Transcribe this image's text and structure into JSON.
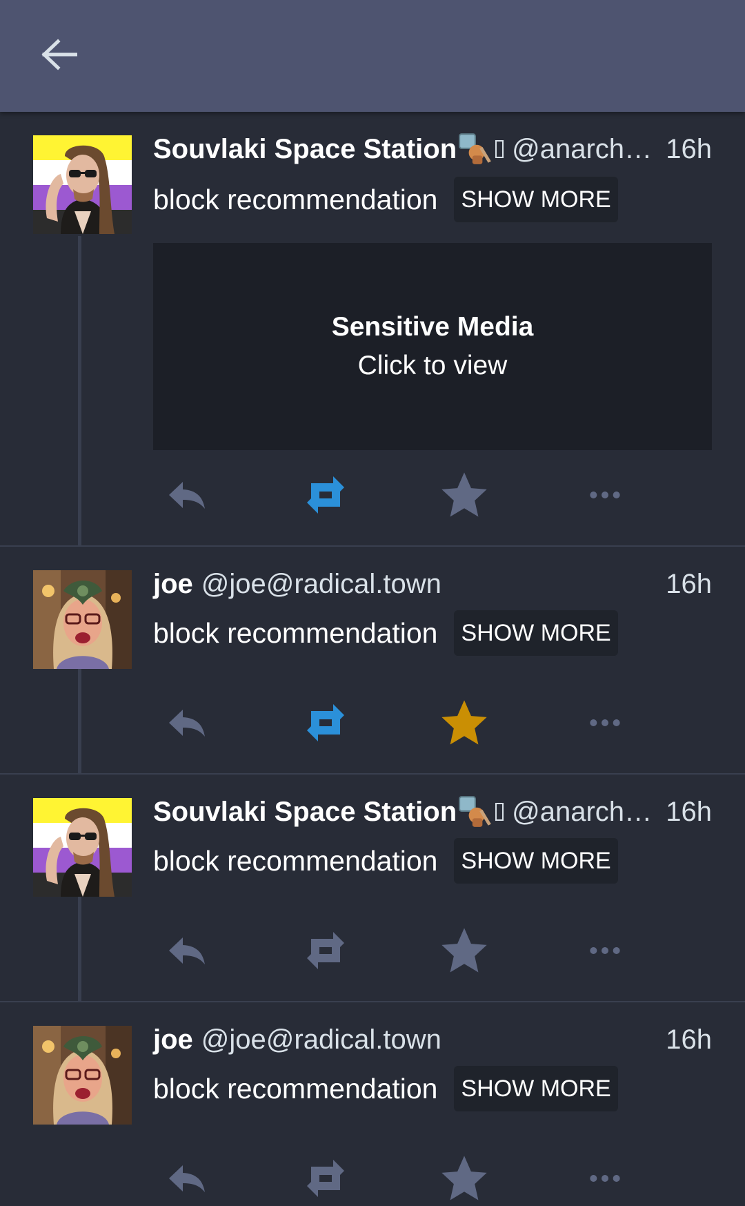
{
  "header": {
    "back_icon": "arrow-left-icon"
  },
  "colors": {
    "background": "#282c37",
    "header": "#4e5470",
    "icon_default": "#606984",
    "boosted": "#2b90d9",
    "favourited": "#ca8f04"
  },
  "statuses": [
    {
      "display_name": "Souvlaki Space Station",
      "account": "@anarchi…",
      "time": "16h",
      "content": "block recommendation",
      "show_more": "SHOW MORE",
      "sensitive": {
        "title": "Sensitive Media",
        "subtitle": "Click to view"
      },
      "boosted": true,
      "favourited": false,
      "avatar": "nonbinary-flag-avatar"
    },
    {
      "display_name": "joe",
      "account": "@joe@radical.town",
      "time": "16h",
      "content": "block recommendation",
      "show_more": "SHOW MORE",
      "boosted": true,
      "favourited": true,
      "avatar": "joe-avatar"
    },
    {
      "display_name": "Souvlaki Space Station",
      "account": "@anarchi…",
      "time": "16h",
      "content": "block recommendation",
      "show_more": "SHOW MORE",
      "boosted": false,
      "favourited": false,
      "avatar": "nonbinary-flag-avatar"
    },
    {
      "display_name": "joe",
      "account": "@joe@radical.town",
      "time": "16h",
      "content": "block recommendation",
      "show_more": "SHOW MORE",
      "boosted": false,
      "favourited": false,
      "avatar": "joe-avatar"
    }
  ]
}
